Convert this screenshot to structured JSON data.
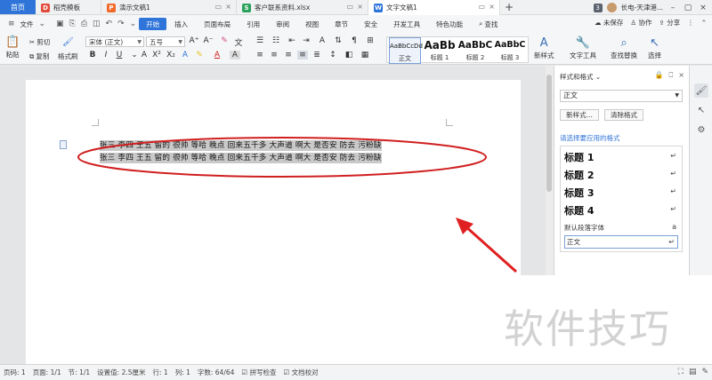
{
  "tabs": {
    "home": "首页",
    "items": [
      {
        "label": "稻壳模板",
        "icon": "docer-icon"
      },
      {
        "label": "演示文稿1",
        "icon": "ppt-icon"
      },
      {
        "label": "客户联系资料.xlsx",
        "icon": "excel-icon"
      },
      {
        "label": "文字文稿1",
        "icon": "word-icon"
      }
    ],
    "new_tab": "+",
    "badge": "3",
    "user": "长电-天津港..."
  },
  "menu": {
    "file": "文件",
    "items": [
      "开始",
      "插入",
      "页面布局",
      "引用",
      "审阅",
      "视图",
      "章节",
      "安全",
      "开发工具",
      "特色功能"
    ],
    "search": "查找",
    "unsaved": "未保存",
    "collab": "协作",
    "share": "分享"
  },
  "ribbon": {
    "paste": "粘贴",
    "cut": "剪切",
    "copy": "复制",
    "format_painter": "格式刷",
    "font_name": "宋体 (正文)",
    "font_size": "五号",
    "styles": [
      {
        "preview": "AaBbCcDd",
        "name": "正文"
      },
      {
        "preview": "AaBb",
        "name": "标题 1"
      },
      {
        "preview": "AaBbC",
        "name": "标题 2"
      },
      {
        "preview": "AaBbC",
        "name": "标题 3"
      }
    ],
    "new_style": "新样式",
    "text_tools": "文字工具",
    "find_replace": "查找替换",
    "select": "选择"
  },
  "document": {
    "lines": [
      "张三  李四  王五  留的  很帅    等哈  晚点  回来五千多  大声道  啊大  是否安  防去  污粉缺",
      "张三  李四  王五  留的  很帅    等哈  晚点  回来五千多  大声道  啊大  是否安  防去  污粉缺"
    ]
  },
  "pane": {
    "title": "样式和格式",
    "current_style": "正文",
    "new_style_btn": "新样式...",
    "clear_btn": "清除格式",
    "apply_label": "请选择要应用的格式",
    "styles": [
      {
        "name": "标题  1",
        "mark": "↵"
      },
      {
        "name": "标题  2",
        "mark": "↵"
      },
      {
        "name": "标题  3",
        "mark": "↵"
      },
      {
        "name": "标题  4",
        "mark": "↵"
      }
    ],
    "default_font": "默认段落字体",
    "default_mark": "a",
    "selected": "正文",
    "selected_mark": "↵"
  },
  "status": {
    "page": "页码: 1",
    "pages": "页面: 1/1",
    "section": "节: 1/1",
    "setting": "设置值: 2.5厘米",
    "row": "行: 1",
    "col": "列: 1",
    "words": "字数: 64/64",
    "spell": "拼写检查",
    "proof": "文档校对"
  },
  "watermark": "软件技巧",
  "colors": {
    "accent": "#2f74d8",
    "ellipse": "#d01f1f",
    "arrow": "#e02020",
    "highlight": "#c9c9c9"
  }
}
